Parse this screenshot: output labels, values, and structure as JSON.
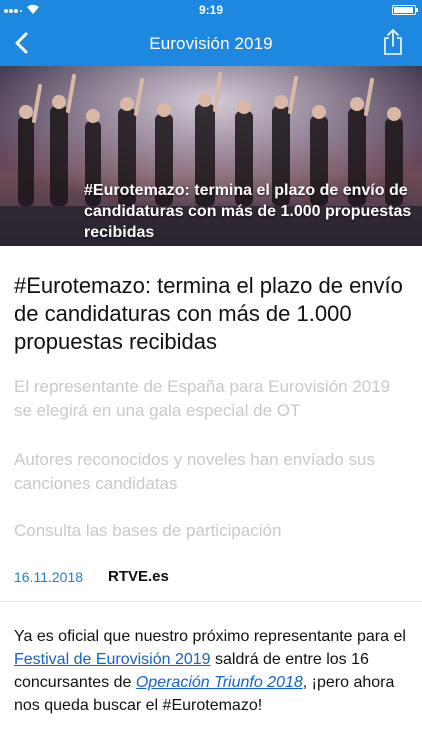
{
  "status_bar": {
    "time": "9:19"
  },
  "nav": {
    "title": "Eurovisión 2019",
    "back_icon": "chevron-left-icon",
    "share_icon": "share-icon"
  },
  "hero": {
    "caption": "#Eurotemazo: termina el plazo de envío de candidaturas con más de 1.000 propuestas recibidas"
  },
  "article": {
    "headline": "#Eurotemazo: termina el plazo de envío de candidaturas con más de 1.000 propuestas recibidas",
    "subtitles": [
      "El representante de España para Eurovisión 2019 se elegirá en una gala especial de OT",
      "Autores reconocidos y noveles han envíado sus canciones candidatas",
      "Consulta las bases de participación"
    ],
    "date": "16.11.2018",
    "source": "RTVE.es",
    "body": {
      "part1": "Ya es oficial que nuestro próximo representante para el ",
      "link1": "Festival de Eurovisión 2019",
      "part2": " saldrá de entre los 16 concursantes de ",
      "link2": "Operación Triunfo 2018",
      "part3": ", ¡pero ahora nos queda buscar el #Eurotemazo!"
    }
  },
  "colors": {
    "accent": "#1e88e0",
    "link": "#1563c8",
    "subtitle": "#c9c9c9",
    "date": "#1e7fd1"
  }
}
